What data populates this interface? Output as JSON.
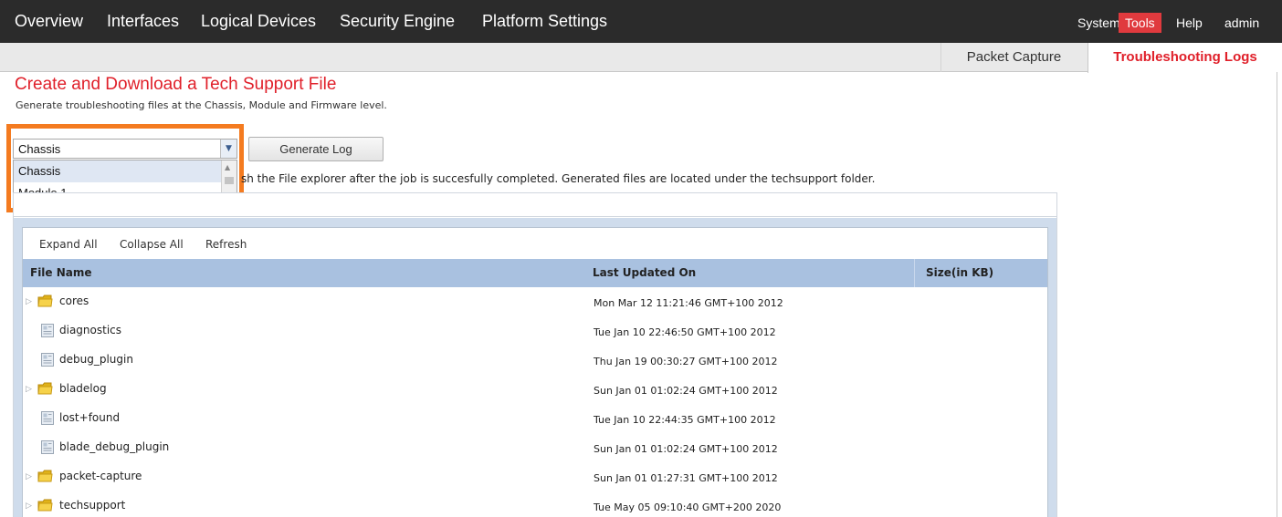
{
  "topnav": {
    "items": [
      "Overview",
      "Interfaces",
      "Logical Devices",
      "Security Engine",
      "Platform Settings"
    ],
    "utility": [
      "System",
      "Tools",
      "Help",
      "admin"
    ],
    "active_utility": "Tools"
  },
  "subnav": {
    "packet_capture": "Packet Capture",
    "troubleshooting_logs": "Troubleshooting Logs"
  },
  "page": {
    "title": "Create and Download a Tech Support File",
    "subtitle": "Generate troubleshooting files at the Chassis, Module and Firmware level.",
    "info_suffix": "sh the File explorer after the job is succesfully completed. Generated files are located under the techsupport folder."
  },
  "level_select": {
    "value": "Chassis",
    "options": [
      "Chassis",
      "Module 1"
    ],
    "highlighted_option": "Chassis"
  },
  "generate_button": {
    "label": "Generate Log"
  },
  "explorer": {
    "toolbar": {
      "expand_all": "Expand All",
      "collapse_all": "Collapse All",
      "refresh": "Refresh"
    },
    "columns": {
      "name": "File Name",
      "updated": "Last Updated On",
      "size": "Size(in KB)"
    },
    "rows": [
      {
        "name": "cores",
        "type": "folder",
        "updated": "Mon Mar 12 11:21:46 GMT+100 2012"
      },
      {
        "name": "diagnostics",
        "type": "file",
        "updated": "Tue Jan 10 22:46:50 GMT+100 2012"
      },
      {
        "name": "debug_plugin",
        "type": "file",
        "updated": "Thu Jan 19 00:30:27 GMT+100 2012"
      },
      {
        "name": "bladelog",
        "type": "folder",
        "updated": "Sun Jan 01 01:02:24 GMT+100 2012"
      },
      {
        "name": "lost+found",
        "type": "file",
        "updated": "Tue Jan 10 22:44:35 GMT+100 2012"
      },
      {
        "name": "blade_debug_plugin",
        "type": "file",
        "updated": "Sun Jan 01 01:02:24 GMT+100 2012"
      },
      {
        "name": "packet-capture",
        "type": "folder",
        "updated": "Sun Jan 01 01:27:31 GMT+100 2012"
      },
      {
        "name": "techsupport",
        "type": "folder",
        "updated": "Tue May 05 09:10:40 GMT+200 2020"
      }
    ]
  },
  "colors": {
    "accent_red": "#e0202a",
    "highlight_orange": "#f47b20",
    "header_blue": "#a9c1e0",
    "topbar": "#2b2b2b"
  },
  "icons": {
    "folder": "folder-icon",
    "file": "file-icon",
    "expander": "tree-expander-icon",
    "dropdown": "chevron-down-icon"
  }
}
